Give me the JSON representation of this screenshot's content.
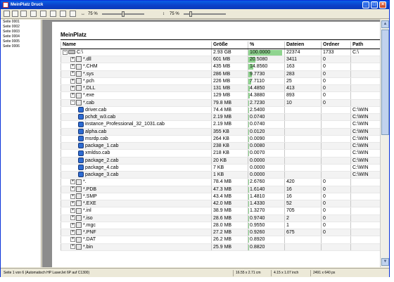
{
  "window": {
    "title": "MeinPlatz Druck"
  },
  "toolbar": {
    "zoom1": "75 %",
    "zoom2": "75 %"
  },
  "sidebar": {
    "items": [
      "Seite 0001",
      "Seite 0002",
      "Seite 0003",
      "Seite 0004",
      "Seite 0005",
      "Seite 0006"
    ]
  },
  "report": {
    "title": "MeinPlatz",
    "columns": [
      "Name",
      "Größe",
      "%",
      "Dateien",
      "Ordner",
      "Path"
    ],
    "rows": [
      {
        "name": "C:\\",
        "size": "2.93 GB",
        "pct": "100.0000",
        "pct_value": 100.0,
        "files": "22374",
        "folders": "1733",
        "path": "C:\\",
        "level": 0,
        "icon": "drive",
        "exp": "-"
      },
      {
        "name": "*.dll",
        "size": "601 MB",
        "pct": "20.5080",
        "pct_value": 20.508,
        "files": "3411",
        "folders": "0",
        "path": "",
        "level": 1,
        "icon": "file",
        "exp": "+"
      },
      {
        "name": "*.CHM",
        "size": "435 MB",
        "pct": "14.8560",
        "pct_value": 14.856,
        "files": "163",
        "folders": "0",
        "path": "",
        "level": 1,
        "icon": "file",
        "exp": "+"
      },
      {
        "name": "*.sys",
        "size": "286 MB",
        "pct": "9.7730",
        "pct_value": 9.773,
        "files": "283",
        "folders": "0",
        "path": "",
        "level": 1,
        "icon": "file",
        "exp": "+"
      },
      {
        "name": "*.pch",
        "size": "226 MB",
        "pct": "7.7110",
        "pct_value": 7.711,
        "files": "25",
        "folders": "0",
        "path": "",
        "level": 1,
        "icon": "file",
        "exp": "+"
      },
      {
        "name": "*.DLL",
        "size": "131 MB",
        "pct": "4.4850",
        "pct_value": 4.485,
        "files": "413",
        "folders": "0",
        "path": "",
        "level": 1,
        "icon": "file",
        "exp": "+"
      },
      {
        "name": "*.exe",
        "size": "129 MB",
        "pct": "4.3880",
        "pct_value": 4.388,
        "files": "893",
        "folders": "0",
        "path": "",
        "level": 1,
        "icon": "file",
        "exp": "+"
      },
      {
        "name": "*.cab",
        "size": "79.8 MB",
        "pct": "2.7230",
        "pct_value": 2.723,
        "files": "10",
        "folders": "0",
        "path": "",
        "level": 1,
        "icon": "file",
        "exp": "-"
      },
      {
        "name": "driver.cab",
        "size": "74.4 MB",
        "pct": "2.5400",
        "pct_value": 2.54,
        "files": "",
        "folders": "",
        "path": "C:\\WIN",
        "level": 2,
        "icon": "cab",
        "exp": ""
      },
      {
        "name": "pchdt_w3.cab",
        "size": "2.19 MB",
        "pct": "0.0740",
        "pct_value": 0.074,
        "files": "",
        "folders": "",
        "path": "C:\\WIN",
        "level": 2,
        "icon": "cab",
        "exp": ""
      },
      {
        "name": "instance_Professional_32_1031.cab",
        "size": "2.19 MB",
        "pct": "0.0740",
        "pct_value": 0.074,
        "files": "",
        "folders": "",
        "path": "C:\\WIN",
        "level": 2,
        "icon": "cab",
        "exp": ""
      },
      {
        "name": "alpha.cab",
        "size": "355 KB",
        "pct": "0.0120",
        "pct_value": 0.012,
        "files": "",
        "folders": "",
        "path": "C:\\WIN",
        "level": 2,
        "icon": "cab",
        "exp": ""
      },
      {
        "name": "msrdp.cab",
        "size": "264 KB",
        "pct": "0.0090",
        "pct_value": 0.009,
        "files": "",
        "folders": "",
        "path": "C:\\WIN",
        "level": 2,
        "icon": "cab",
        "exp": ""
      },
      {
        "name": "package_1.cab",
        "size": "238 KB",
        "pct": "0.0080",
        "pct_value": 0.008,
        "files": "",
        "folders": "",
        "path": "C:\\WIN",
        "level": 2,
        "icon": "cab",
        "exp": ""
      },
      {
        "name": "xmldso.cab",
        "size": "218 KB",
        "pct": "0.0070",
        "pct_value": 0.007,
        "files": "",
        "folders": "",
        "path": "C:\\WIN",
        "level": 2,
        "icon": "cab",
        "exp": ""
      },
      {
        "name": "package_2.cab",
        "size": "20 KB",
        "pct": "0.0000",
        "pct_value": 0.0,
        "files": "",
        "folders": "",
        "path": "C:\\WIN",
        "level": 2,
        "icon": "cab",
        "exp": ""
      },
      {
        "name": "package_4.cab",
        "size": "7 KB",
        "pct": "0.0000",
        "pct_value": 0.0,
        "files": "",
        "folders": "",
        "path": "C:\\WIN",
        "level": 2,
        "icon": "cab",
        "exp": ""
      },
      {
        "name": "package_3.cab",
        "size": "1 KB",
        "pct": "0.0000",
        "pct_value": 0.0,
        "files": "",
        "folders": "",
        "path": "C:\\WIN",
        "level": 2,
        "icon": "cab",
        "exp": ""
      },
      {
        "name": "*.",
        "size": "78.4 MB",
        "pct": "2.6760",
        "pct_value": 2.676,
        "files": "420",
        "folders": "0",
        "path": "",
        "level": 1,
        "icon": "file",
        "exp": "+"
      },
      {
        "name": "*.PDB",
        "size": "47.3 MB",
        "pct": "1.6140",
        "pct_value": 1.614,
        "files": "16",
        "folders": "0",
        "path": "",
        "level": 1,
        "icon": "file",
        "exp": "+"
      },
      {
        "name": "*.SMP",
        "size": "43.4 MB",
        "pct": "1.4810",
        "pct_value": 1.481,
        "files": "16",
        "folders": "0",
        "path": "",
        "level": 1,
        "icon": "file",
        "exp": "+"
      },
      {
        "name": "*.EXE",
        "size": "42.0 MB",
        "pct": "1.4330",
        "pct_value": 1.433,
        "files": "52",
        "folders": "0",
        "path": "",
        "level": 1,
        "icon": "file",
        "exp": "+"
      },
      {
        "name": "*.inl",
        "size": "38.9 MB",
        "pct": "1.3270",
        "pct_value": 1.327,
        "files": "705",
        "folders": "0",
        "path": "",
        "level": 1,
        "icon": "file",
        "exp": "+"
      },
      {
        "name": "*.iso",
        "size": "28.6 MB",
        "pct": "0.9740",
        "pct_value": 0.974,
        "files": "2",
        "folders": "0",
        "path": "",
        "level": 1,
        "icon": "file",
        "exp": "+"
      },
      {
        "name": "*.mgc",
        "size": "28.0 MB",
        "pct": "0.9550",
        "pct_value": 0.955,
        "files": "1",
        "folders": "0",
        "path": "",
        "level": 1,
        "icon": "file",
        "exp": "+"
      },
      {
        "name": "*.PNF",
        "size": "27.2 MB",
        "pct": "0.9260",
        "pct_value": 0.926,
        "files": "675",
        "folders": "0",
        "path": "",
        "level": 1,
        "icon": "file",
        "exp": "+"
      },
      {
        "name": "*.DAT",
        "size": "26.2 MB",
        "pct": "0.8920",
        "pct_value": 0.892,
        "files": "",
        "folders": "",
        "path": "",
        "level": 1,
        "icon": "file",
        "exp": "+"
      },
      {
        "name": "*.bin",
        "size": "25.9 MB",
        "pct": "0.8820",
        "pct_value": 0.882,
        "files": "",
        "folders": "",
        "path": "",
        "level": 1,
        "icon": "file",
        "exp": "+"
      }
    ]
  },
  "statusbar": {
    "left": "Seite 1 von 6 (Automatisch HP LaserJet 6P auf C1300)",
    "cell1": "16.55 x 2.71 cm",
    "cell2": "4.15 x 1.07 inch",
    "cell3": "2491 x 640 px"
  }
}
